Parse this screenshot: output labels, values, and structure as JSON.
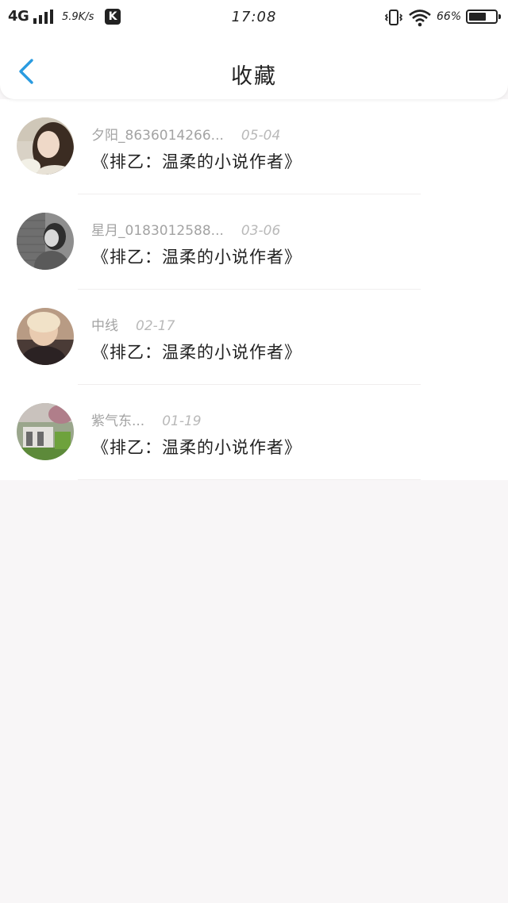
{
  "status_bar": {
    "network": "4G",
    "speed": "5.9K/s",
    "app_badge": "K",
    "time": "17:08",
    "battery_percent": "66%",
    "battery_level": 0.66
  },
  "header": {
    "title": "收藏",
    "back_icon": "chevron-left-icon",
    "accent_color": "#2a9be0"
  },
  "favorites": [
    {
      "user": "夕阳_8636014266...",
      "date": "05-04",
      "title": "《排乙：温柔的小说作者》"
    },
    {
      "user": "星月_0183012588...",
      "date": "03-06",
      "title": "《排乙：温柔的小说作者》"
    },
    {
      "user": "中线",
      "date": "02-17",
      "title": "《排乙：温柔的小说作者》"
    },
    {
      "user": "紫气东...",
      "date": "01-19",
      "title": "《排乙：温柔的小说作者》"
    }
  ]
}
